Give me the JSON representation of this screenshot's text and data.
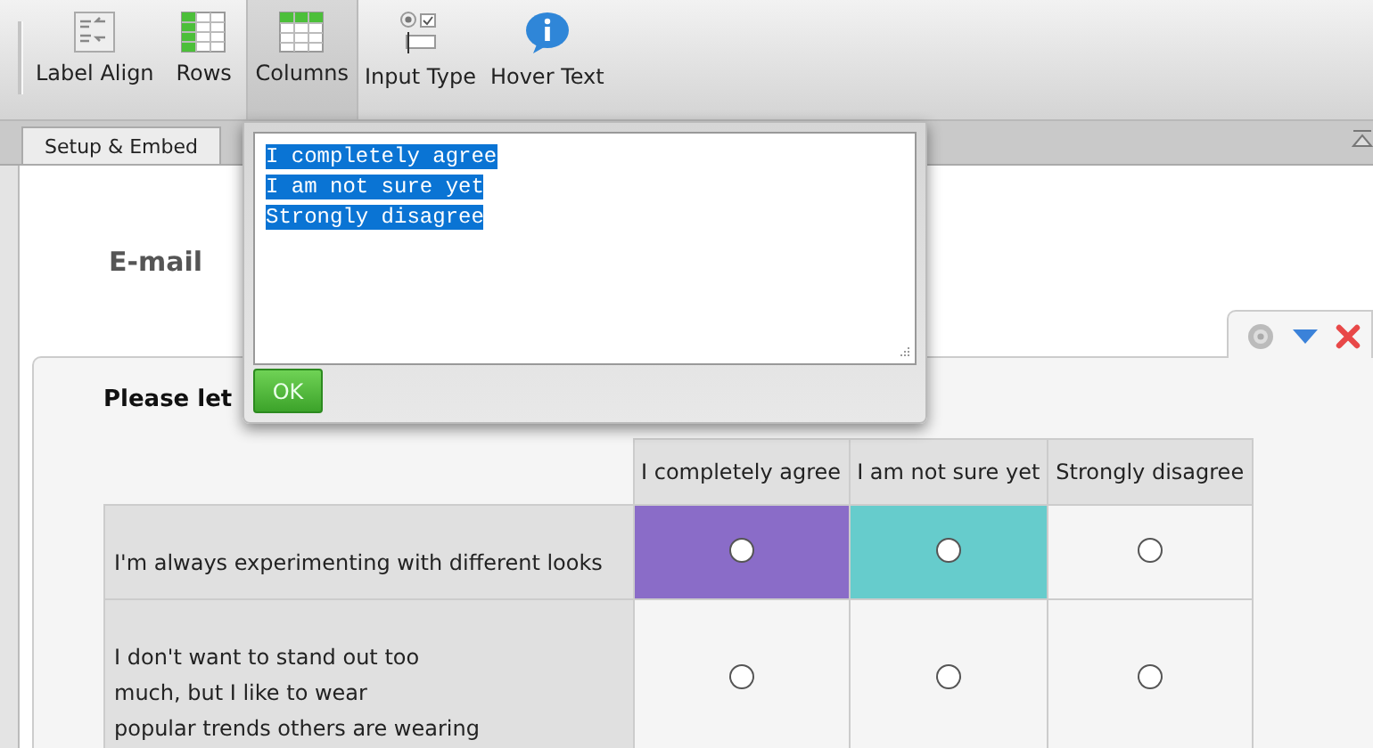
{
  "toolbar": {
    "buttons": [
      {
        "label": "Label Align",
        "kind": "align",
        "selected": false
      },
      {
        "label": "Rows",
        "kind": "rows",
        "selected": false
      },
      {
        "label": "Columns",
        "kind": "columns",
        "selected": true
      },
      {
        "label": "Input Type",
        "kind": "input",
        "selected": false
      },
      {
        "label": "Hover Text",
        "kind": "info",
        "selected": false
      }
    ]
  },
  "tabs": [
    {
      "label": "Setup & Embed",
      "selected": true
    }
  ],
  "field_label": "E-mail",
  "question": {
    "title": "Please let",
    "columns": [
      "I completely agree",
      "I am not sure yet",
      "Strongly disagree"
    ],
    "rows": [
      {
        "label": "I'm always experimenting with different looks",
        "cells": [
          {
            "color": "#8a6cc8"
          },
          {
            "color": "#66cccc"
          },
          {
            "color": "#f5f5f5"
          }
        ]
      },
      {
        "label": "I don't want to stand out too\nmuch, but I like to wear\npopular trends others are wearing",
        "cells": [
          {
            "color": "#f5f5f5"
          },
          {
            "color": "#f5f5f5"
          },
          {
            "color": "#f5f5f5"
          }
        ]
      }
    ]
  },
  "popup": {
    "options": "I completely agree\nI am not sure yet\nStrongly disagree",
    "button": "OK"
  }
}
